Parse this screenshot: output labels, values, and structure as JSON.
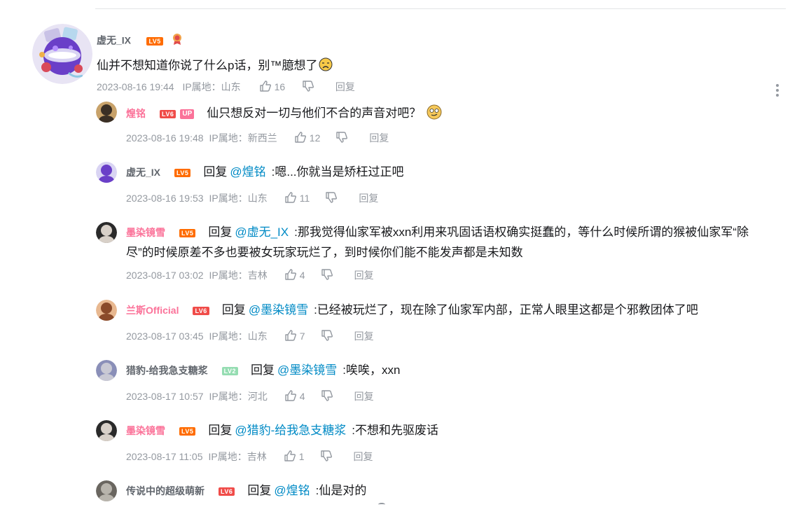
{
  "main": {
    "username": "虚无_IX",
    "level": "LV5",
    "content": "仙并不想知道你说了什么p话，别™臆想了",
    "emoji": "sad-face-emoji",
    "time": "2023-08-16 19:44",
    "ip_label": "IP属地：山东",
    "likes": "16",
    "reply_label": "回复"
  },
  "replies": [
    {
      "username": "煌铭",
      "name_color": "#fb7299",
      "level": "LV6",
      "badge": "UP",
      "reply_word": "",
      "at": "",
      "content": "仙只想反对一切与他们不合的声音对吧？",
      "content2": "",
      "time": "2023-08-16 19:48",
      "ip_label": "IP属地：新西兰",
      "likes": "12",
      "reply_label": "回复"
    },
    {
      "username": "虚无_IX",
      "name_color": "#61666d",
      "level": "LV5",
      "badge": "",
      "reply_word": "回复",
      "at": "@煌铭",
      "content": ":嗯...你就当是矫枉过正吧",
      "content2": "",
      "time": "2023-08-16 19:53",
      "ip_label": "IP属地：山东",
      "likes": "11",
      "reply_label": "回复"
    },
    {
      "username": "墨染镜雪",
      "name_color": "#fb7299",
      "level": "LV5",
      "badge": "",
      "reply_word": "回复",
      "at": "@虚无_IX",
      "content": ":那我觉得仙家军被xxn利用来巩固话语权确实挺蠢的，等什么时候所谓的猴被仙家军“除",
      "content2": "尽”的时候原差不多也要被女玩家玩烂了，到时候你们能不能发声都是未知数",
      "time": "2023-08-17 03:02",
      "ip_label": "IP属地：吉林",
      "likes": "4",
      "reply_label": "回复"
    },
    {
      "username": "兰斯Official",
      "name_color": "#fb7299",
      "level": "LV6",
      "badge": "",
      "reply_word": "回复",
      "at": "@墨染镜雪",
      "content": ":已经被玩烂了，现在除了仙家军内部，正常人眼里这都是个邪教团体了吧",
      "content2": "",
      "time": "2023-08-17 03:45",
      "ip_label": "IP属地：山东",
      "likes": "7",
      "reply_label": "回复"
    },
    {
      "username": "猎豹-给我急支糖浆",
      "name_color": "#61666d",
      "level": "LV2",
      "badge": "",
      "reply_word": "回复",
      "at": "@墨染镜雪",
      "content": ":唉唉，xxn",
      "content2": "",
      "time": "2023-08-17 10:57",
      "ip_label": "IP属地：河北",
      "likes": "4",
      "reply_label": "回复"
    },
    {
      "username": "墨染镜雪",
      "name_color": "#fb7299",
      "level": "LV5",
      "badge": "",
      "reply_word": "回复",
      "at": "@猎豹-给我急支糖浆",
      "content": ":不想和先驱废话",
      "content2": "",
      "time": "2023-08-17 11:05",
      "ip_label": "IP属地：吉林",
      "likes": "1",
      "reply_label": "回复"
    },
    {
      "username": "传说中的超级萌新",
      "name_color": "#61666d",
      "level": "LV6",
      "badge": "",
      "reply_word": "回复",
      "at": "@煌铭",
      "content": ":仙是对的",
      "content2": "",
      "time": "",
      "ip_label": "",
      "likes": "",
      "reply_label": ""
    }
  ],
  "icons": {
    "like": "thumb-up-icon",
    "dislike": "thumb-down-icon",
    "more": "more-vertical-icon",
    "medal": "medal-badge-icon"
  },
  "colors": {
    "pink_name": "#fb7299",
    "link": "#008ac5",
    "meta": "#9499a0",
    "lv5": "#ff6c00",
    "lv6": "#f04c49"
  }
}
